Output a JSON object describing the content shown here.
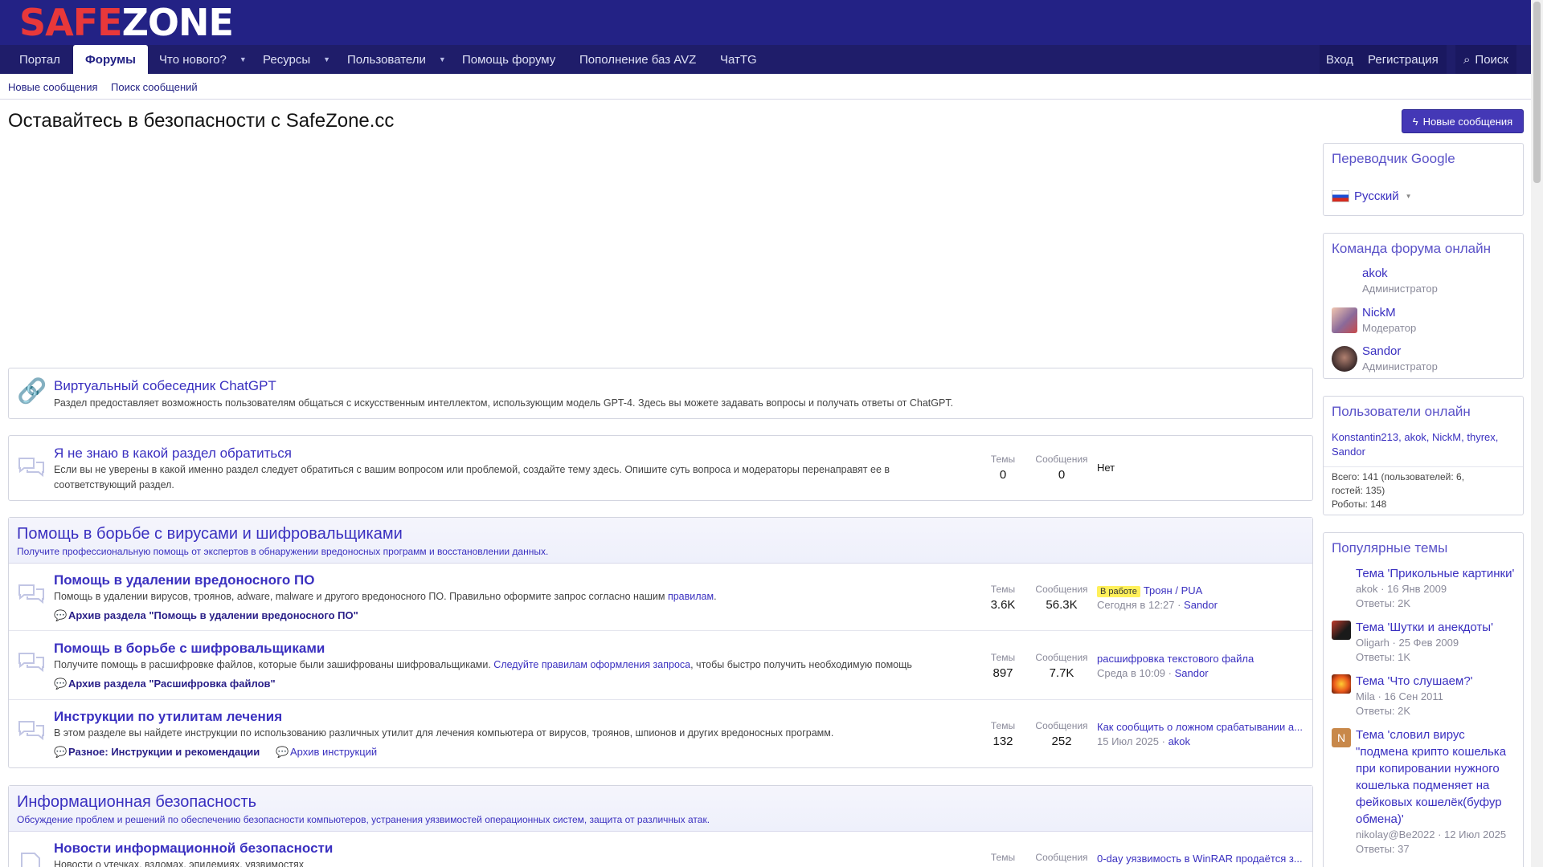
{
  "logo": {
    "part1": "SAFE",
    "part2": "ZONE"
  },
  "nav": {
    "items": [
      {
        "label": "Портал"
      },
      {
        "label": "Форумы"
      },
      {
        "label": "Что нового?"
      },
      {
        "label": "Ресурсы"
      },
      {
        "label": "Пользователи"
      },
      {
        "label": "Помощь форуму"
      },
      {
        "label": "Пополнение баз AVZ"
      },
      {
        "label": "ЧатTG"
      }
    ],
    "login": "Вход",
    "register": "Регистрация",
    "search": "Поиск"
  },
  "subnav": {
    "new_posts": "Новые сообщения",
    "search_posts": "Поиск сообщений"
  },
  "page": {
    "title": "Оставайтесь в безопасности с SafeZone.cc",
    "new_posts_button": "Новые сообщения"
  },
  "forums": {
    "chatgpt": {
      "title": "Виртуальный собеседник ChatGPT",
      "desc": "Раздел предоставляет возможность пользователям общаться с искусственным интеллектом, использующим модель GPT-4. Здесь вы можете задавать вопросы и получать ответы от ChatGPT."
    },
    "unknown": {
      "title": "Я не знаю в какой раздел обратиться",
      "desc": "Если вы не уверены в какой именно раздел следует обратиться с вашим вопросом или проблемой, создайте тему здесь. Опишите суть вопроса и модераторы перенаправят ее в соответствующий раздел.",
      "themes_label": "Темы",
      "themes": "0",
      "posts_label": "Сообщения",
      "posts": "0",
      "latest": "Нет"
    }
  },
  "cat1": {
    "title": "Помощь в борьбе с вирусами и шифровальщиками",
    "desc": "Получите профессиональную помощь от экспертов в обнаружении вредоносных программ и восстановлении данных.",
    "nodes": [
      {
        "title": "Помощь в удалении вредоносного ПО",
        "desc": "Помощь в удалении вирусов, троянов, adware, malware и другого вредоносного ПО. Правильно оформите запрос согласно нашим ",
        "desc_link": "правилам",
        "desc_end": ".",
        "sub1": "Архив раздела \"Помощь в удалении вредоносного ПО\"",
        "themes_label": "Темы",
        "themes": "3.6K",
        "posts_label": "Сообщения",
        "posts": "56.3K",
        "badge": "В работе",
        "latest": "Троян / PUA",
        "date": "Сегодня в 12:27",
        "user": "Sandor"
      },
      {
        "title": "Помощь в борьбе с шифровальщиками",
        "desc": "Получите помощь в расшифровке файлов, которые были зашифрованы шифровальщиками. ",
        "desc_link": "Следуйте правилам оформления запроса",
        "desc_end": ", чтобы быстро получить необходимую помощь",
        "sub1": "Архив раздела \"Расшифровка файлов\"",
        "themes_label": "Темы",
        "themes": "897",
        "posts_label": "Сообщения",
        "posts": "7.7K",
        "latest": "расшифровка текстового файла",
        "date": "Среда в 10:09",
        "user": "Sandor"
      },
      {
        "title": "Инструкции по утилитам лечения",
        "desc": "В этом разделе вы найдете инструкции по использованию различных утилит для лечения компьютера от вирусов, троянов, шпионов и других вредоносных программ.",
        "sub1": "Разное: Инструкции и рекомендации",
        "sub2": "Архив инструкций",
        "themes_label": "Темы",
        "themes": "132",
        "posts_label": "Сообщения",
        "posts": "252",
        "latest": "Как сообщить о ложном срабатывании а...",
        "date": "15 Июл 2025",
        "user": "akok"
      }
    ]
  },
  "cat2": {
    "title": "Информационная безопасность",
    "desc": "Обсуждение проблем и решений по обеспечению безопасности компьютеров, устранения уязвимостей операционных систем, защита от различных атак.",
    "node": {
      "title": "Новости информационной безопасности",
      "desc": "Новости о утечках, взломах, эпидемиях, уязвимостях",
      "themes_label": "Темы",
      "posts_label": "Сообщения",
      "latest": "0-day уязвимость в WinRAR продаётся з..."
    }
  },
  "sidebar": {
    "translator": {
      "title": "Переводчик Google",
      "lang": "Русский"
    },
    "staff": {
      "title": "Команда форума онлайн",
      "members": [
        {
          "name": "akok",
          "role": "Администратор"
        },
        {
          "name": "NickM",
          "role": "Модератор"
        },
        {
          "name": "Sandor",
          "role": "Администратор"
        }
      ]
    },
    "online": {
      "title": "Пользователи онлайн",
      "users_line1": "Konstantin213, akok, NickM, thyrex,",
      "users_line2": "Sandor",
      "total_line1": "Всего: 141 (пользователей: 6,",
      "total_line2": "гостей: 135)",
      "total_line3": "Роботы: 148"
    },
    "popular": {
      "title": "Популярные темы",
      "items": [
        {
          "title": "Тема 'Прикольные картинки'",
          "user": "akok",
          "date": "16 Янв 2009",
          "replies": "Ответы: 2K"
        },
        {
          "title": "Тема 'Шутки и анекдоты'",
          "user": "Oligarh",
          "date": "25 Фев 2009",
          "replies": "Ответы: 1K"
        },
        {
          "title": "Тема 'Что слушаем?'",
          "user": "Mila",
          "date": "16 Сен 2011",
          "replies": "Ответы: 2K"
        },
        {
          "title": "Тема 'словил вирус \"подмена крипто кошелька при копировании нужного кошелька подменяет на фейковых кошелёк(буфур обмена)'",
          "user": "nikolay@Be2022",
          "date": "12 Июл 2025",
          "replies": "Ответы: 37",
          "avatar_letter": "N"
        }
      ]
    }
  },
  "colors": {
    "header": "#232285",
    "navbar": "#1f1d6a",
    "accent": "#4438b6",
    "link": "#3a30c0",
    "logo_red": "#e8383a"
  }
}
